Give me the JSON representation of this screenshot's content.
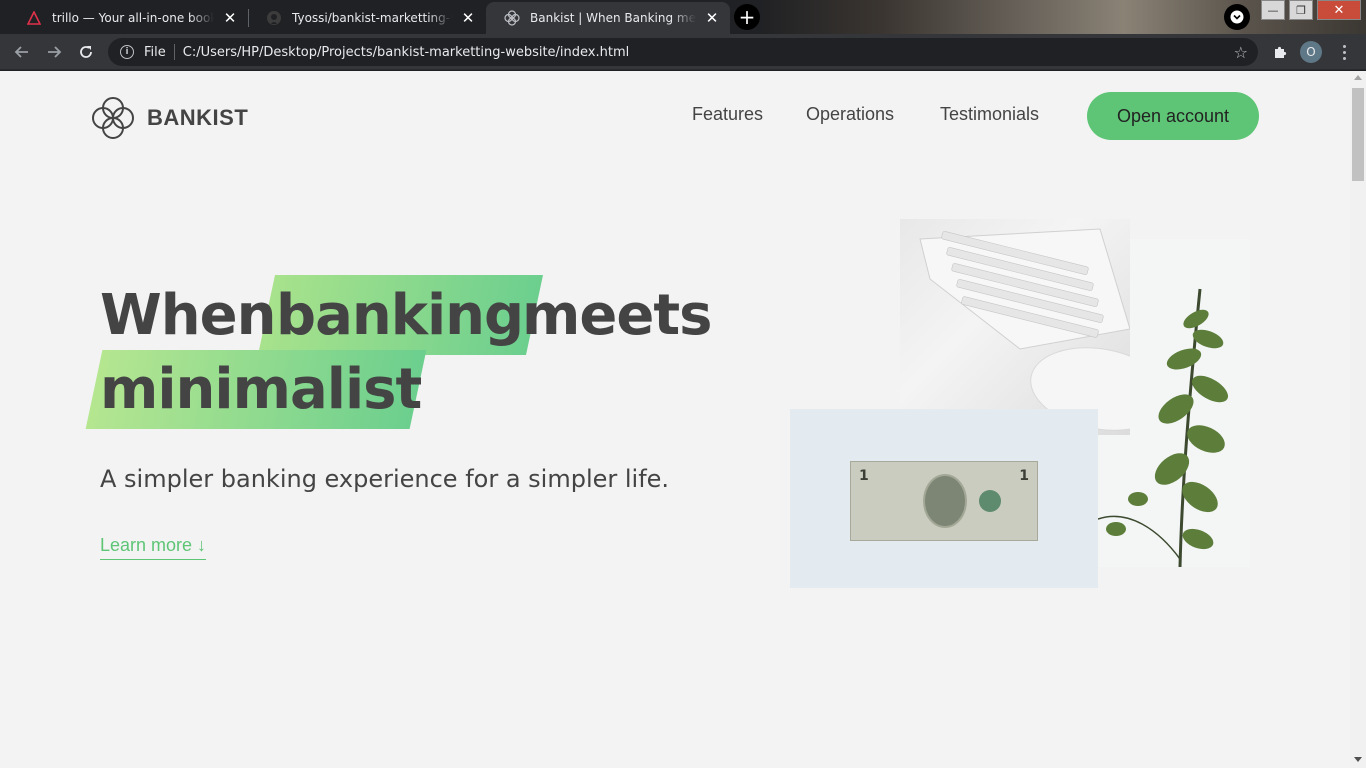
{
  "browser": {
    "tabs": [
      {
        "title": "trillo — Your all-in-one booking app"
      },
      {
        "title": "Tyossi/bankist-marketting-website"
      },
      {
        "title": "Bankist | When Banking meets Minimalist"
      }
    ],
    "address": {
      "scheme_label": "File",
      "url": "C:/Users/HP/Desktop/Projects/bankist-marketting-website/index.html"
    },
    "profile_initial": "O"
  },
  "page": {
    "logo_text": "BANKIST",
    "nav": {
      "features": "Features",
      "operations": "Operations",
      "testimonials": "Testimonials",
      "open_account": "Open account"
    },
    "hero": {
      "title_word1": "When",
      "title_word2": "banking",
      "title_word3": "meets",
      "title_word4": "minimalist",
      "subtitle": "A simpler banking experience for a simpler life.",
      "learn_more": "Learn more ↓"
    }
  },
  "colors": {
    "accent": "#5ec576",
    "highlight_start": "#a8e28c",
    "highlight_end": "#6ccf8e",
    "page_bg": "#f3f3f3",
    "text": "#444444"
  }
}
